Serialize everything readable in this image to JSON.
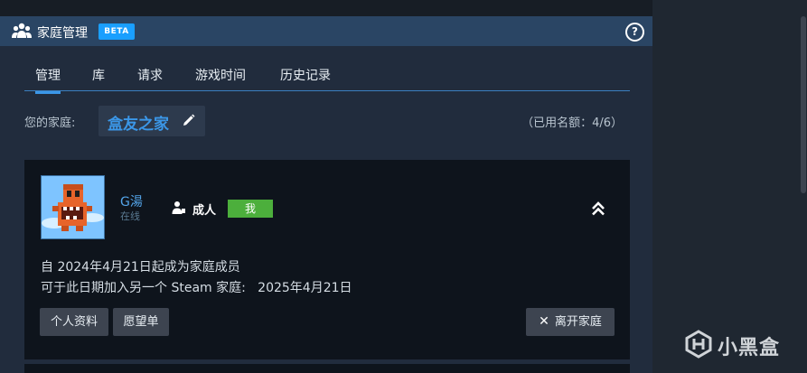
{
  "header": {
    "title": "家庭管理",
    "badge": "BETA",
    "help_icon": "?"
  },
  "tabs": [
    {
      "label": "管理",
      "active": true
    },
    {
      "label": "库"
    },
    {
      "label": "请求"
    },
    {
      "label": "游戏时间"
    },
    {
      "label": "历史记录"
    }
  ],
  "family": {
    "label": "您的家庭:",
    "name": "盒友之家",
    "quota": "（已用名额：4/6）"
  },
  "member": {
    "name": "G湯",
    "status": "在线",
    "role": "成人",
    "me_badge": "我",
    "since": "自 2024年4月21日起成为家庭成员",
    "join_info": "可于此日期加入另一个 Steam 家庭:   2025年4月21日"
  },
  "buttons": {
    "profile": "个人资料",
    "wishlist": "愿望单",
    "leave": "离开家庭"
  },
  "watermark": {
    "text": "小黑盒"
  },
  "colors": {
    "accent": "#1a9fff",
    "link": "#53a4e8",
    "me_badge": "#4caf3c",
    "header_bg": "#2a4564"
  }
}
